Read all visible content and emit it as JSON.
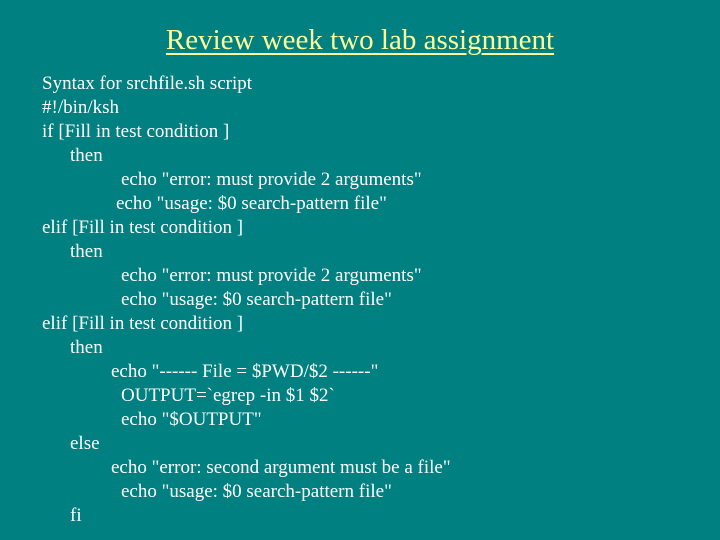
{
  "slide": {
    "title": "Review week two lab assignment",
    "colors": {
      "background": "#008080",
      "title": "#ffff99",
      "body_text": "#ffffff"
    },
    "lines": [
      {
        "text": "Syntax for srchfile.sh script",
        "indent": 0
      },
      {
        "text": "#!/bin/ksh",
        "indent": 0
      },
      {
        "text": "if [Fill in test condition ]",
        "indent": 0
      },
      {
        "text": "then",
        "indent": 1
      },
      {
        "text": "echo \"error: must provide 2 arguments\"",
        "indent": 3
      },
      {
        "text": "echo \"usage: $0 search-pattern file\"",
        "indent": 2
      },
      {
        "text": "elif [Fill in test condition ]",
        "indent": 0
      },
      {
        "text": "then",
        "indent": 1
      },
      {
        "text": "echo \"error: must provide 2 arguments\"",
        "indent": 3
      },
      {
        "text": "echo \"usage: $0 search-pattern file\"",
        "indent": 3
      },
      {
        "text": "elif [Fill in test condition ]",
        "indent": 0
      },
      {
        "text": "then",
        "indent": 1
      },
      {
        "text": "echo \"------ File = $PWD/$2 ------\"",
        "indent": 2
      },
      {
        "text": "OUTPUT=`egrep -in $1 $2`",
        "indent": 3
      },
      {
        "text": "echo \"$OUTPUT\"",
        "indent": 3
      },
      {
        "text": "else",
        "indent": 1
      },
      {
        "text": "echo \"error: second argument must be a file\"",
        "indent": 2
      },
      {
        "text": "echo \"usage: $0 search-pattern file\"",
        "indent": 3
      },
      {
        "text": "fi",
        "indent": 1
      }
    ]
  }
}
